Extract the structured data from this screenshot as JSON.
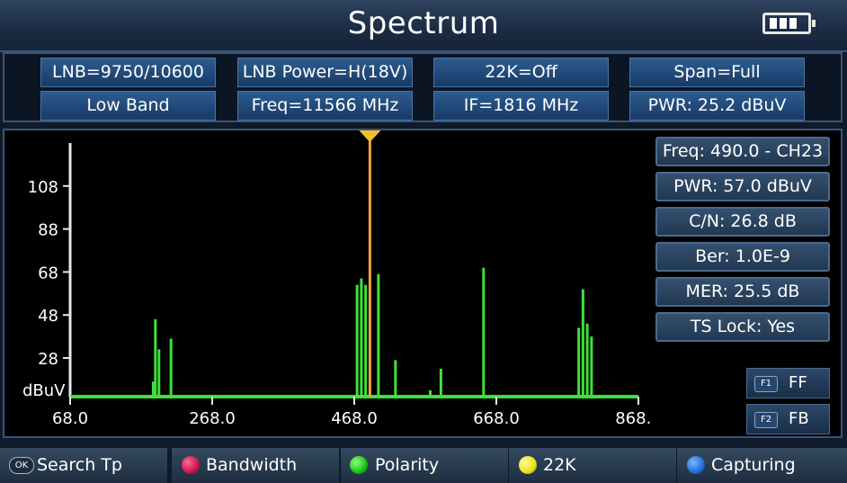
{
  "header": {
    "title": "Spectrum",
    "battery_icon": "battery-icon"
  },
  "settings": {
    "row1": [
      "LNB=9750/10600",
      "LNB Power=H(18V)",
      "22K=Off",
      "Span=Full"
    ],
    "row2": [
      "Low Band",
      "Freq=11566 MHz",
      "IF=1816 MHz",
      "PWR: 25.2 dBuV"
    ]
  },
  "info": {
    "freq": "Freq: 490.0 - CH23",
    "pwr": "PWR: 57.0 dBuV",
    "cn": "C/N: 26.8 dB",
    "ber": "Ber: 1.0E-9",
    "mer": "MER: 25.5 dB",
    "ts": "TS Lock: Yes"
  },
  "fkeys": {
    "f1_tag": "F1",
    "f1_label": "FF",
    "f2_tag": "F2",
    "f2_label": "FB"
  },
  "bottom": {
    "ok_badge": "OK",
    "search": "Search Tp",
    "bandwidth": "Bandwidth",
    "polarity": "Polarity",
    "k22": "22K",
    "capturing": "Capturing"
  },
  "colors": {
    "red": "#c8174f",
    "green": "#19c216",
    "yellow": "#e6e21a",
    "blue": "#1e6fd6",
    "spectrum": "#3ee03a",
    "marker": "#f0a040"
  },
  "chart_data": {
    "type": "bar",
    "ylabel": "dBuV",
    "xlim": [
      68.0,
      868.0
    ],
    "ylim": [
      10,
      128
    ],
    "xticks": [
      "68.0",
      "268.0",
      "468.0",
      "668.0",
      "868.0"
    ],
    "yticks": [
      "108",
      "88",
      "68",
      "48",
      "28"
    ],
    "marker_x": 490.0,
    "x": [
      185,
      188,
      193,
      210,
      472,
      478,
      484,
      502,
      526,
      575,
      590,
      650,
      784,
      790,
      796,
      802
    ],
    "values": [
      17,
      46,
      32,
      37,
      62,
      65,
      62,
      67,
      27,
      13,
      23,
      70,
      42,
      60,
      44,
      38
    ]
  }
}
